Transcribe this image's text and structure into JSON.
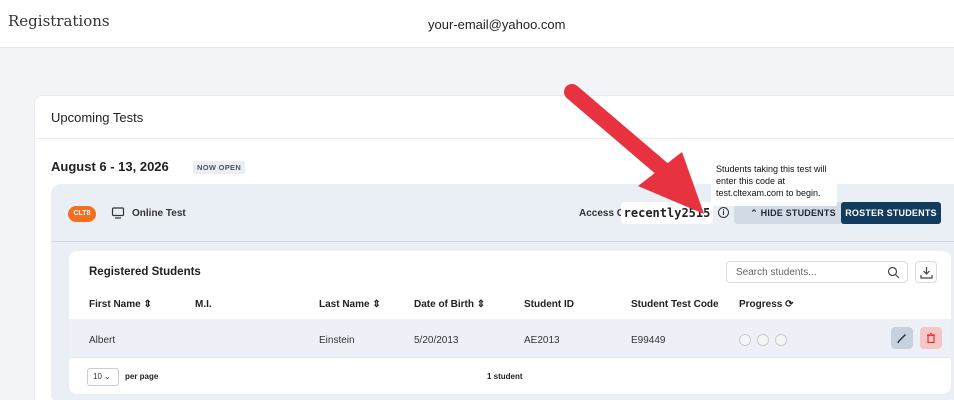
{
  "header": {
    "brand": "Registrations",
    "email": "your-email@yahoo.com"
  },
  "card": {
    "title": "Upcoming Tests",
    "date_range": "August 6 - 13, 2026",
    "status_badge": "NOW OPEN"
  },
  "test": {
    "type_badge": "CLT8",
    "mode_label": "Online Test",
    "access_code_label": "Access Code:",
    "access_code": "recently2515",
    "hide_students_label": "HIDE STUDENTS",
    "roster_students_label": "ROSTER STUDENTS",
    "tooltip": "Students taking this test will enter this code at test.cltexam.com to begin."
  },
  "students": {
    "title": "Registered Students",
    "search_placeholder": "Search students...",
    "columns": [
      "First Name",
      "M.I.",
      "Last Name",
      "Date of Birth",
      "Student ID",
      "Student Test Code",
      "Progress"
    ],
    "rows": [
      {
        "first": "Albert",
        "mi": "",
        "last": "Einstein",
        "dob": "5/20/2013",
        "student_id": "AE2013",
        "test_code": "E99449"
      }
    ],
    "per_page_value": "10",
    "per_page_label": "per page",
    "count_label": "1 student"
  },
  "colors": {
    "accent_orange": "#f36f21",
    "primary_navy": "#123c5e",
    "arrow_red": "#e8323f"
  }
}
